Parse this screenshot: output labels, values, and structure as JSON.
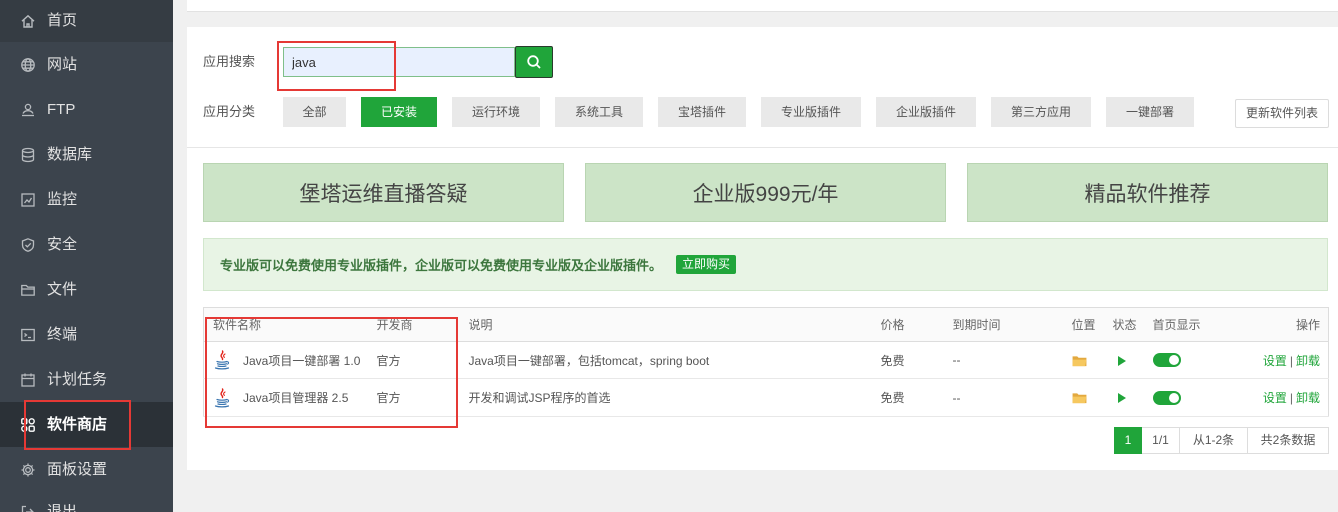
{
  "colors": {
    "accent": "#20a53a",
    "sidebar_bg": "#3c444d",
    "sidebar_active_bg": "#2b3137",
    "annotation": "#e53935",
    "banner_bg": "#cce4c7",
    "notice_bg": "#e8f4e5"
  },
  "sidebar": {
    "items": [
      {
        "label": "首页",
        "icon": "home-icon"
      },
      {
        "label": "网站",
        "icon": "globe-icon"
      },
      {
        "label": "FTP",
        "icon": "ftp-icon"
      },
      {
        "label": "数据库",
        "icon": "database-icon"
      },
      {
        "label": "监控",
        "icon": "monitor-icon"
      },
      {
        "label": "安全",
        "icon": "shield-icon"
      },
      {
        "label": "文件",
        "icon": "folder-icon"
      },
      {
        "label": "终端",
        "icon": "terminal-icon"
      },
      {
        "label": "计划任务",
        "icon": "calendar-icon"
      },
      {
        "label": "软件商店",
        "icon": "apps-icon",
        "active": true
      },
      {
        "label": "面板设置",
        "icon": "gear-icon"
      },
      {
        "label": "退出",
        "icon": "logout-icon"
      }
    ]
  },
  "search": {
    "label": "应用搜索",
    "value": "java",
    "button_icon": "search-icon"
  },
  "category": {
    "label": "应用分类",
    "items": [
      {
        "label": "全部"
      },
      {
        "label": "已安装",
        "active": true
      },
      {
        "label": "运行环境"
      },
      {
        "label": "系统工具"
      },
      {
        "label": "宝塔插件"
      },
      {
        "label": "专业版插件"
      },
      {
        "label": "企业版插件"
      },
      {
        "label": "第三方应用"
      },
      {
        "label": "一键部署"
      }
    ],
    "refresh_label": "更新软件列表"
  },
  "banners": [
    "堡塔运维直播答疑",
    "企业版999元/年",
    "精品软件推荐"
  ],
  "notice": {
    "text": "专业版可以免费使用专业版插件，企业版可以免费使用专业版及企业版插件。",
    "button": "立即购买"
  },
  "table": {
    "columns": [
      "软件名称",
      "开发商",
      "说明",
      "价格",
      "到期时间",
      "位置",
      "状态",
      "首页显示",
      "操作"
    ],
    "rows": [
      {
        "icon": "java-icon",
        "name": "Java项目一键部署 1.0",
        "vendor": "官方",
        "description": "Java项目一键部署，包括tomcat，spring boot",
        "price": "免费",
        "expires": "--",
        "location_icon": "folder-icon",
        "status_icon": "play-icon",
        "home_display": true,
        "actions": {
          "settings": "设置",
          "separator": "|",
          "uninstall": "卸载"
        }
      },
      {
        "icon": "java-icon",
        "name": "Java项目管理器 2.5",
        "vendor": "官方",
        "description": "开发和调试JSP程序的首选",
        "price": "免费",
        "expires": "--",
        "location_icon": "folder-icon",
        "status_icon": "play-icon",
        "home_display": true,
        "actions": {
          "settings": "设置",
          "separator": "|",
          "uninstall": "卸载"
        }
      }
    ]
  },
  "pagination": {
    "current": "1",
    "pages": "1/1",
    "range": "从1-2条",
    "total": "共2条数据"
  }
}
